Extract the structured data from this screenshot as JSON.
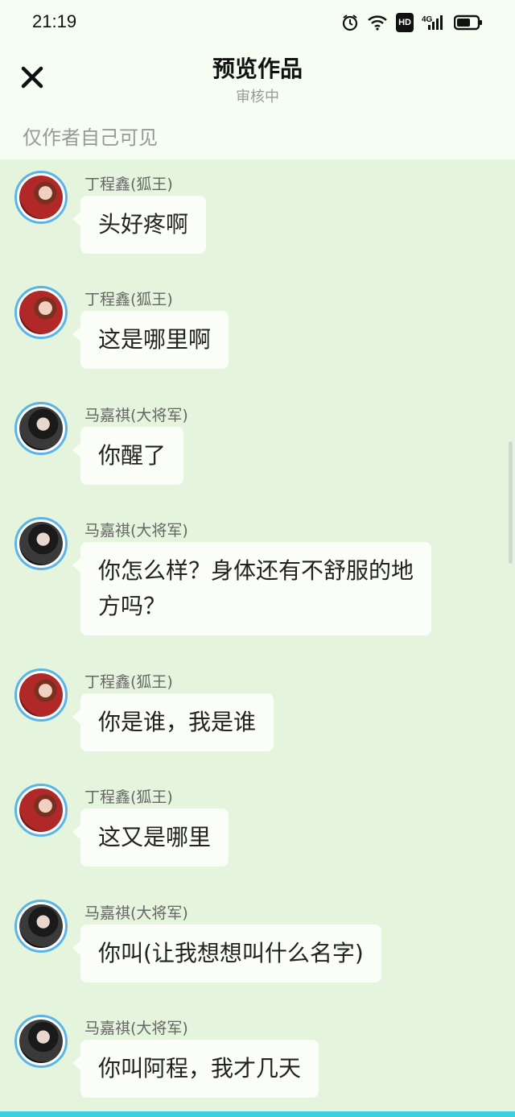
{
  "status_bar": {
    "time": "21:19",
    "icons": [
      "alarm-icon",
      "wifi-icon",
      "hd-icon",
      "signal-4g-icon",
      "battery-icon"
    ],
    "hd_label": "HD",
    "network_label": "4G"
  },
  "header": {
    "close_icon": "close-icon",
    "title": "预览作品",
    "subtitle": "审核中",
    "visibility": "仅作者自己可见"
  },
  "messages": [
    {
      "speaker": "丁程鑫(狐王)",
      "text": "头好疼啊",
      "avatar": "ding"
    },
    {
      "speaker": "丁程鑫(狐王)",
      "text": "这是哪里啊",
      "avatar": "ding"
    },
    {
      "speaker": "马嘉祺(大将军)",
      "text": "你醒了",
      "avatar": "ma"
    },
    {
      "speaker": "马嘉祺(大将军)",
      "text": "你怎么样？身体还有不舒服的地方吗？",
      "avatar": "ma"
    },
    {
      "speaker": "丁程鑫(狐王)",
      "text": "你是谁，我是谁",
      "avatar": "ding"
    },
    {
      "speaker": "丁程鑫(狐王)",
      "text": "这又是哪里",
      "avatar": "ding"
    },
    {
      "speaker": "马嘉祺(大将军)",
      "text": "你叫(让我想想叫什么名字)",
      "avatar": "ma"
    },
    {
      "speaker": "马嘉祺(大将军)",
      "text": "你叫阿程，我才几天",
      "avatar": "ma"
    }
  ],
  "colors": {
    "background": "#e4f4dd",
    "header_bg": "#f6fdf3",
    "avatar_ring": "#5ab4e8",
    "bubble": "#fbfdf9",
    "bottom_accent": "#3ecfe0"
  }
}
